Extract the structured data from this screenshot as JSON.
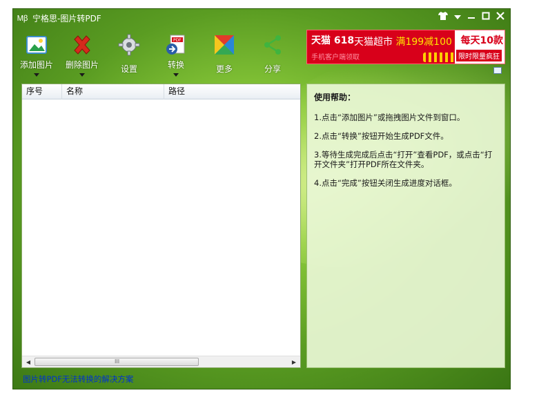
{
  "window": {
    "title": "宁格思-图片转PDF",
    "app_icon": "app-logo-icon"
  },
  "title_controls": {
    "skin_icon": "shirt-icon",
    "menu_icon": "dropdown-menu-icon",
    "minimize_icon": "minimize-icon",
    "maximize_icon": "maximize-icon",
    "close_icon": "close-icon"
  },
  "toolbar": {
    "add_label": "添加图片",
    "delete_label": "删除图片",
    "settings_label": "设置",
    "convert_label": "转换",
    "more_label": "更多",
    "share_label": "分享"
  },
  "ad": {
    "brand_text": "天猫 618",
    "headline": "天猫超市",
    "promo": "满199减100",
    "sub_text": "手机客户端领取",
    "right_a": "每天10款",
    "right_b": "限时限量疯狂"
  },
  "list": {
    "columns": [
      "序号",
      "名称",
      "路径"
    ],
    "rows": [],
    "scroll_grip": "III"
  },
  "help": {
    "title": "使用帮助：",
    "steps": [
      "1.点击“添加图片”或拖拽图片文件到窗口。",
      "2.点击“转换”按钮开始生成PDF文件。",
      "3.等待生成完成后点击“打开”查看PDF，或点击“打开文件夹”打开PDF所在文件夹。",
      "4.点击“完成”按钮关闭生成进度对话框。"
    ]
  },
  "status": {
    "link_text": "图片转PDF无法转换的解决方案"
  },
  "colors": {
    "window_green": "#5a9c22",
    "ad_red": "#d8001a",
    "link_blue": "#0033cc",
    "help_bg": "#e8f6d4"
  }
}
